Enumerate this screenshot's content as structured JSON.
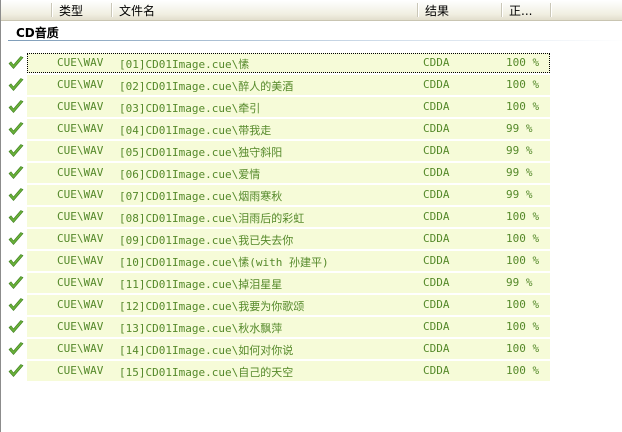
{
  "columns": {
    "type": "类型",
    "filename": "文件名",
    "result": "结果",
    "progress": "正..."
  },
  "group": {
    "label": "CD音质"
  },
  "rows": [
    {
      "type": "CUE\\WAV",
      "file": "[01]CD01Image.cue\\愫",
      "result": "CDDA",
      "pct": "100 %"
    },
    {
      "type": "CUE\\WAV",
      "file": "[02]CD01Image.cue\\醉人的美酒",
      "result": "CDDA",
      "pct": "100 %"
    },
    {
      "type": "CUE\\WAV",
      "file": "[03]CD01Image.cue\\牵引",
      "result": "CDDA",
      "pct": "100 %"
    },
    {
      "type": "CUE\\WAV",
      "file": "[04]CD01Image.cue\\带我走",
      "result": "CDDA",
      "pct": "99 %"
    },
    {
      "type": "CUE\\WAV",
      "file": "[05]CD01Image.cue\\独守斜阳",
      "result": "CDDA",
      "pct": "99 %"
    },
    {
      "type": "CUE\\WAV",
      "file": "[06]CD01Image.cue\\爱情",
      "result": "CDDA",
      "pct": "99 %"
    },
    {
      "type": "CUE\\WAV",
      "file": "[07]CD01Image.cue\\烟雨寒秋",
      "result": "CDDA",
      "pct": "99 %"
    },
    {
      "type": "CUE\\WAV",
      "file": "[08]CD01Image.cue\\泪雨后的彩虹",
      "result": "CDDA",
      "pct": "100 %"
    },
    {
      "type": "CUE\\WAV",
      "file": "[09]CD01Image.cue\\我已失去你",
      "result": "CDDA",
      "pct": "100 %"
    },
    {
      "type": "CUE\\WAV",
      "file": "[10]CD01Image.cue\\愫(with 孙建平)",
      "result": "CDDA",
      "pct": "100 %"
    },
    {
      "type": "CUE\\WAV",
      "file": "[11]CD01Image.cue\\掉泪星星",
      "result": "CDDA",
      "pct": "99 %"
    },
    {
      "type": "CUE\\WAV",
      "file": "[12]CD01Image.cue\\我要为你歌颂",
      "result": "CDDA",
      "pct": "100 %"
    },
    {
      "type": "CUE\\WAV",
      "file": "[13]CD01Image.cue\\秋水飘萍",
      "result": "CDDA",
      "pct": "100 %"
    },
    {
      "type": "CUE\\WAV",
      "file": "[14]CD01Image.cue\\如何对你说",
      "result": "CDDA",
      "pct": "100 %"
    },
    {
      "type": "CUE\\WAV",
      "file": "[15]CD01Image.cue\\自己的天空",
      "result": "CDDA",
      "pct": "100 %"
    }
  ],
  "colors": {
    "row_text": "#55892a",
    "row_background": "#f6fbd8",
    "check": "#6ab23a"
  },
  "icons": {
    "row_status": "checkmark-icon"
  }
}
